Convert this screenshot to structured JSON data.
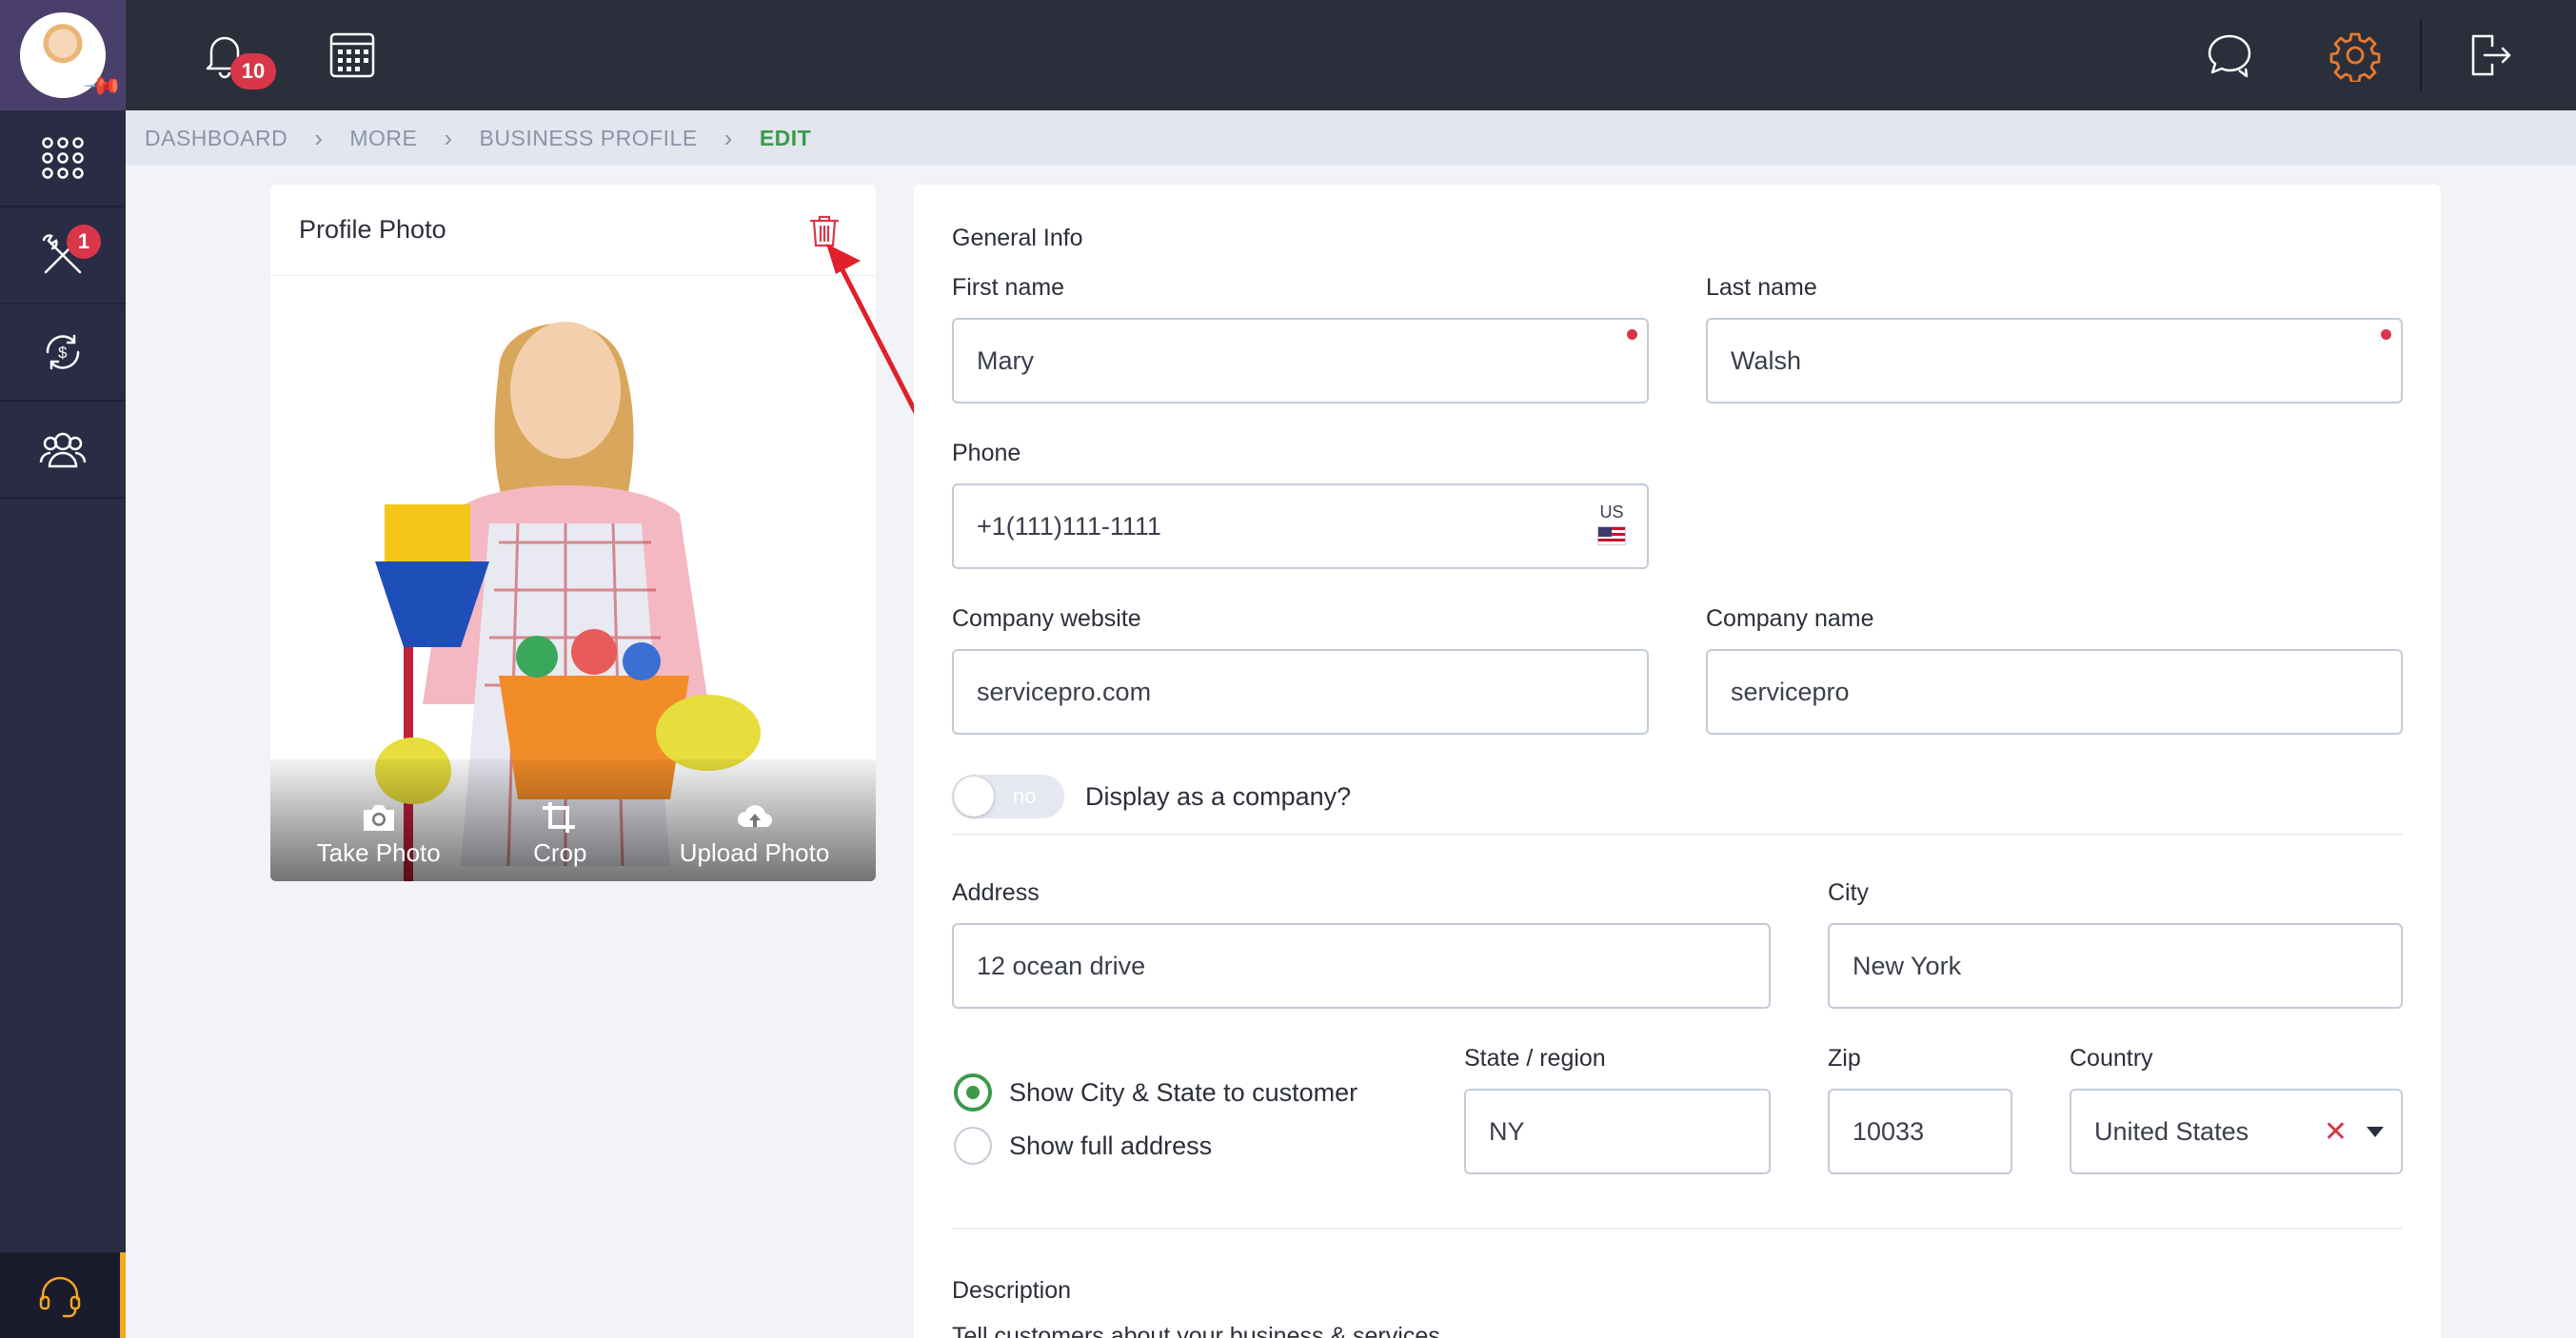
{
  "header": {
    "notification_count": "10",
    "tools_badge": "1"
  },
  "breadcrumb": [
    "DASHBOARD",
    "MORE",
    "BUSINESS PROFILE",
    "EDIT"
  ],
  "photo_card": {
    "title": "Profile Photo",
    "actions": {
      "take_photo": "Take Photo",
      "crop": "Crop",
      "upload_photo": "Upload Photo"
    }
  },
  "form": {
    "section_general": "General Info",
    "first_name": {
      "label": "First name",
      "value": "Mary"
    },
    "last_name": {
      "label": "Last name",
      "value": "Walsh"
    },
    "phone": {
      "label": "Phone",
      "value": "+1(111)111-1111",
      "country_code": "US"
    },
    "company_website": {
      "label": "Company website",
      "value": "servicepro.com"
    },
    "company_name": {
      "label": "Company name",
      "value": "servicepro"
    },
    "display_company": {
      "label": "Display as a company?",
      "state": "no"
    },
    "address": {
      "label": "Address",
      "value": "12 ocean drive"
    },
    "city": {
      "label": "City",
      "value": "New York"
    },
    "address_visibility": {
      "option_city_state": "Show City & State to customer",
      "option_full": "Show full address",
      "selected": "option_city_state"
    },
    "state": {
      "label": "State / region",
      "value": "NY"
    },
    "zip": {
      "label": "Zip",
      "value": "10033"
    },
    "country": {
      "label": "Country",
      "value": "United States"
    },
    "description": {
      "label": "Description",
      "subtext": "Tell customers about your business & services"
    }
  },
  "colors": {
    "accent_green": "#3c9a4b",
    "badge_red": "#d9364a",
    "settings_orange": "#e87a2e",
    "topbar": "#2b2f3b",
    "sidebar": "#2a2c45"
  }
}
